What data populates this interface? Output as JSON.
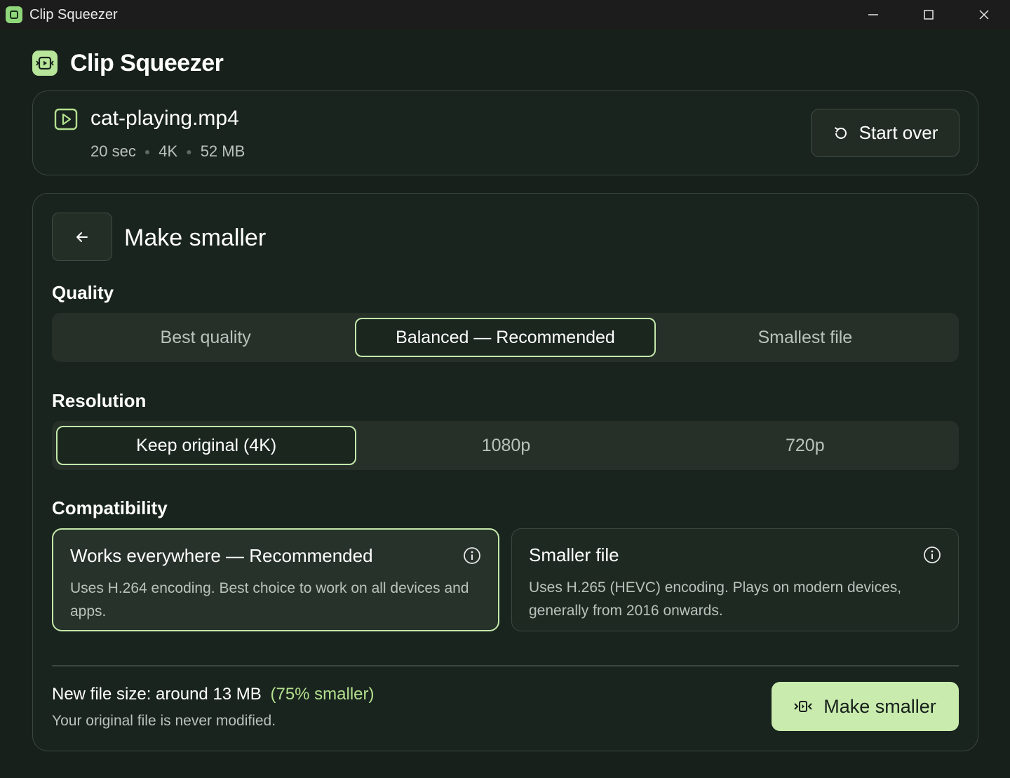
{
  "window": {
    "title": "Clip Squeezer",
    "app_icon": "app-logo-icon",
    "controls": [
      "minimize-icon",
      "maximize-icon",
      "close-icon"
    ]
  },
  "brand": {
    "name": "Clip Squeezer",
    "logo_icon": "app-logo-icon"
  },
  "file": {
    "icon": "video-play-icon",
    "name": "cat-playing.mp4",
    "duration": "20 sec",
    "resolution": "4K",
    "size": "52 MB",
    "start_over_label": "Start over",
    "start_over_icon": "restart-icon"
  },
  "panel": {
    "back_icon": "arrow-left-icon",
    "title": "Make smaller",
    "quality": {
      "label": "Quality",
      "options": [
        "Best quality",
        "Balanced — Recommended",
        "Smallest file"
      ],
      "selected": "Balanced — Recommended"
    },
    "resolution": {
      "label": "Resolution",
      "options": [
        "Keep original (4K)",
        "1080p",
        "720p"
      ],
      "selected": "Keep original (4K)"
    },
    "compatibility": {
      "label": "Compatibility",
      "options": [
        {
          "title": "Works everywhere — Recommended",
          "desc": "Uses H.264 encoding. Best choice to work on all devices and apps.",
          "icon": "info-icon"
        },
        {
          "title": "Smaller file",
          "desc": "Uses H.265 (HEVC) encoding. Plays on modern devices, generally from 2016 onwards.",
          "icon": "info-icon"
        }
      ],
      "selected": "Works everywhere — Recommended"
    },
    "summary": {
      "new_size": "New file size: around 13 MB",
      "reduction": "(75% smaller)",
      "note": "Your original file is never modified."
    },
    "action": {
      "label": "Make smaller",
      "icon": "compress-icon"
    }
  },
  "colors": {
    "background": "#17201b",
    "accent": "#c9ecae",
    "accent_text": "#b3e08f",
    "border": "#3a473f"
  }
}
